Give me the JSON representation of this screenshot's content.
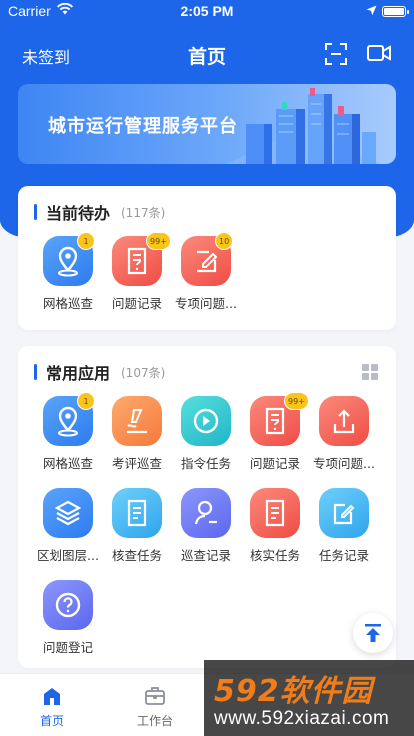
{
  "status_bar": {
    "carrier": "Carrier",
    "time": "2:05 PM"
  },
  "nav": {
    "left_label": "未签到",
    "title": "首页"
  },
  "banner": {
    "text": "城市运行管理服务平台"
  },
  "pending": {
    "title": "当前待办",
    "count": "(117条)",
    "items": [
      {
        "label": "网格巡查",
        "badge": "1",
        "icon": "map-pin-icon",
        "color": "#3a8af6"
      },
      {
        "label": "问题记录",
        "badge": "99+",
        "icon": "question-doc-icon",
        "color": "#f45e54"
      },
      {
        "label": "专项问题...",
        "badge": "10",
        "icon": "edit-doc-icon",
        "color": "#f45e54"
      }
    ]
  },
  "common": {
    "title": "常用应用",
    "count": "(107条)",
    "items": [
      {
        "label": "网格巡查",
        "badge": "1",
        "icon": "map-pin-icon"
      },
      {
        "label": "考评巡查",
        "badge": "",
        "icon": "pen-sign-icon"
      },
      {
        "label": "指令任务",
        "badge": "",
        "icon": "play-circle-icon"
      },
      {
        "label": "问题记录",
        "badge": "99+",
        "icon": "question-doc-icon"
      },
      {
        "label": "专项问题...",
        "badge": "",
        "icon": "upload-tray-icon"
      },
      {
        "label": "区划图层...",
        "badge": "",
        "icon": "layers-icon"
      },
      {
        "label": "核查任务",
        "badge": "",
        "icon": "list-doc-icon"
      },
      {
        "label": "巡查记录",
        "badge": "",
        "icon": "user-search-icon"
      },
      {
        "label": "核实任务",
        "badge": "",
        "icon": "list-doc-icon"
      },
      {
        "label": "任务记录",
        "badge": "",
        "icon": "edit-box-icon"
      },
      {
        "label": "问题登记",
        "badge": "",
        "icon": "question-circle-icon"
      }
    ]
  },
  "tabbar": {
    "tabs": [
      {
        "label": "首页",
        "active": true
      },
      {
        "label": "工作台",
        "active": false
      }
    ]
  },
  "watermark": {
    "brand": "592软件园",
    "url": "www.592xiazai.com"
  },
  "colors": {
    "primary": "#1d66ea",
    "badge": "#fbc41b"
  }
}
